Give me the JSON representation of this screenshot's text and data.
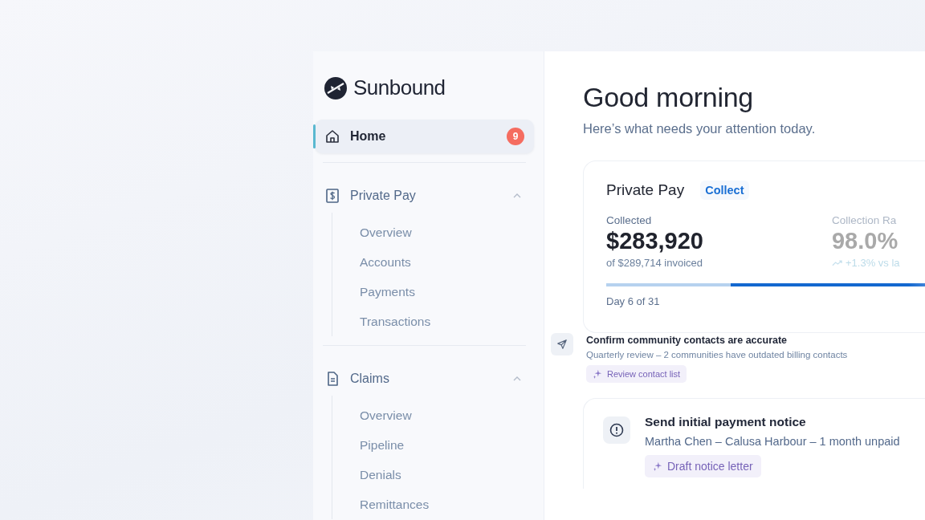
{
  "brand": {
    "name": "Sunbound"
  },
  "nav": [
    {
      "kind": "link",
      "label": "Home",
      "badge": "9",
      "selected": true
    },
    {
      "kind": "section",
      "label": "Private Pay",
      "expanded": true,
      "selected": false,
      "children": [
        {
          "label": "Overview"
        },
        {
          "label": "Accounts"
        },
        {
          "label": "Payments"
        },
        {
          "label": "Transactions"
        }
      ]
    },
    {
      "kind": "section",
      "label": "Claims",
      "expanded": true,
      "selected": false,
      "children": [
        {
          "label": "Overview"
        },
        {
          "label": "Pipeline"
        },
        {
          "label": "Denials"
        },
        {
          "label": "Remittances"
        }
      ]
    }
  ],
  "greeting": {
    "title": "Good morning",
    "subtitle": "Here’s what needs your attention today."
  },
  "summary_card": {
    "title": "Private Pay",
    "tag": "Collect",
    "metrics": [
      {
        "label": "Collected",
        "value": "$283,920",
        "note": "of $289,714 invoiced",
        "trend": false
      },
      {
        "label": "Collection Ra",
        "value": "98.0%",
        "note": "+1.3% vs la",
        "trend": true
      }
    ],
    "progress": {
      "level": 0.33,
      "label": "Day 6 of 31"
    }
  },
  "tasks": [
    {
      "kind": "floating",
      "title": "Confirm community contacts are accurate",
      "detail": "Quarterly review – 2 communities have outdated billing contacts",
      "action": "Review contact list"
    },
    {
      "kind": "card",
      "title": "Send initial payment notice",
      "detail": "Martha Chen – Calusa Harbour – 1 month unpaid",
      "action": "Draft notice letter"
    }
  ]
}
